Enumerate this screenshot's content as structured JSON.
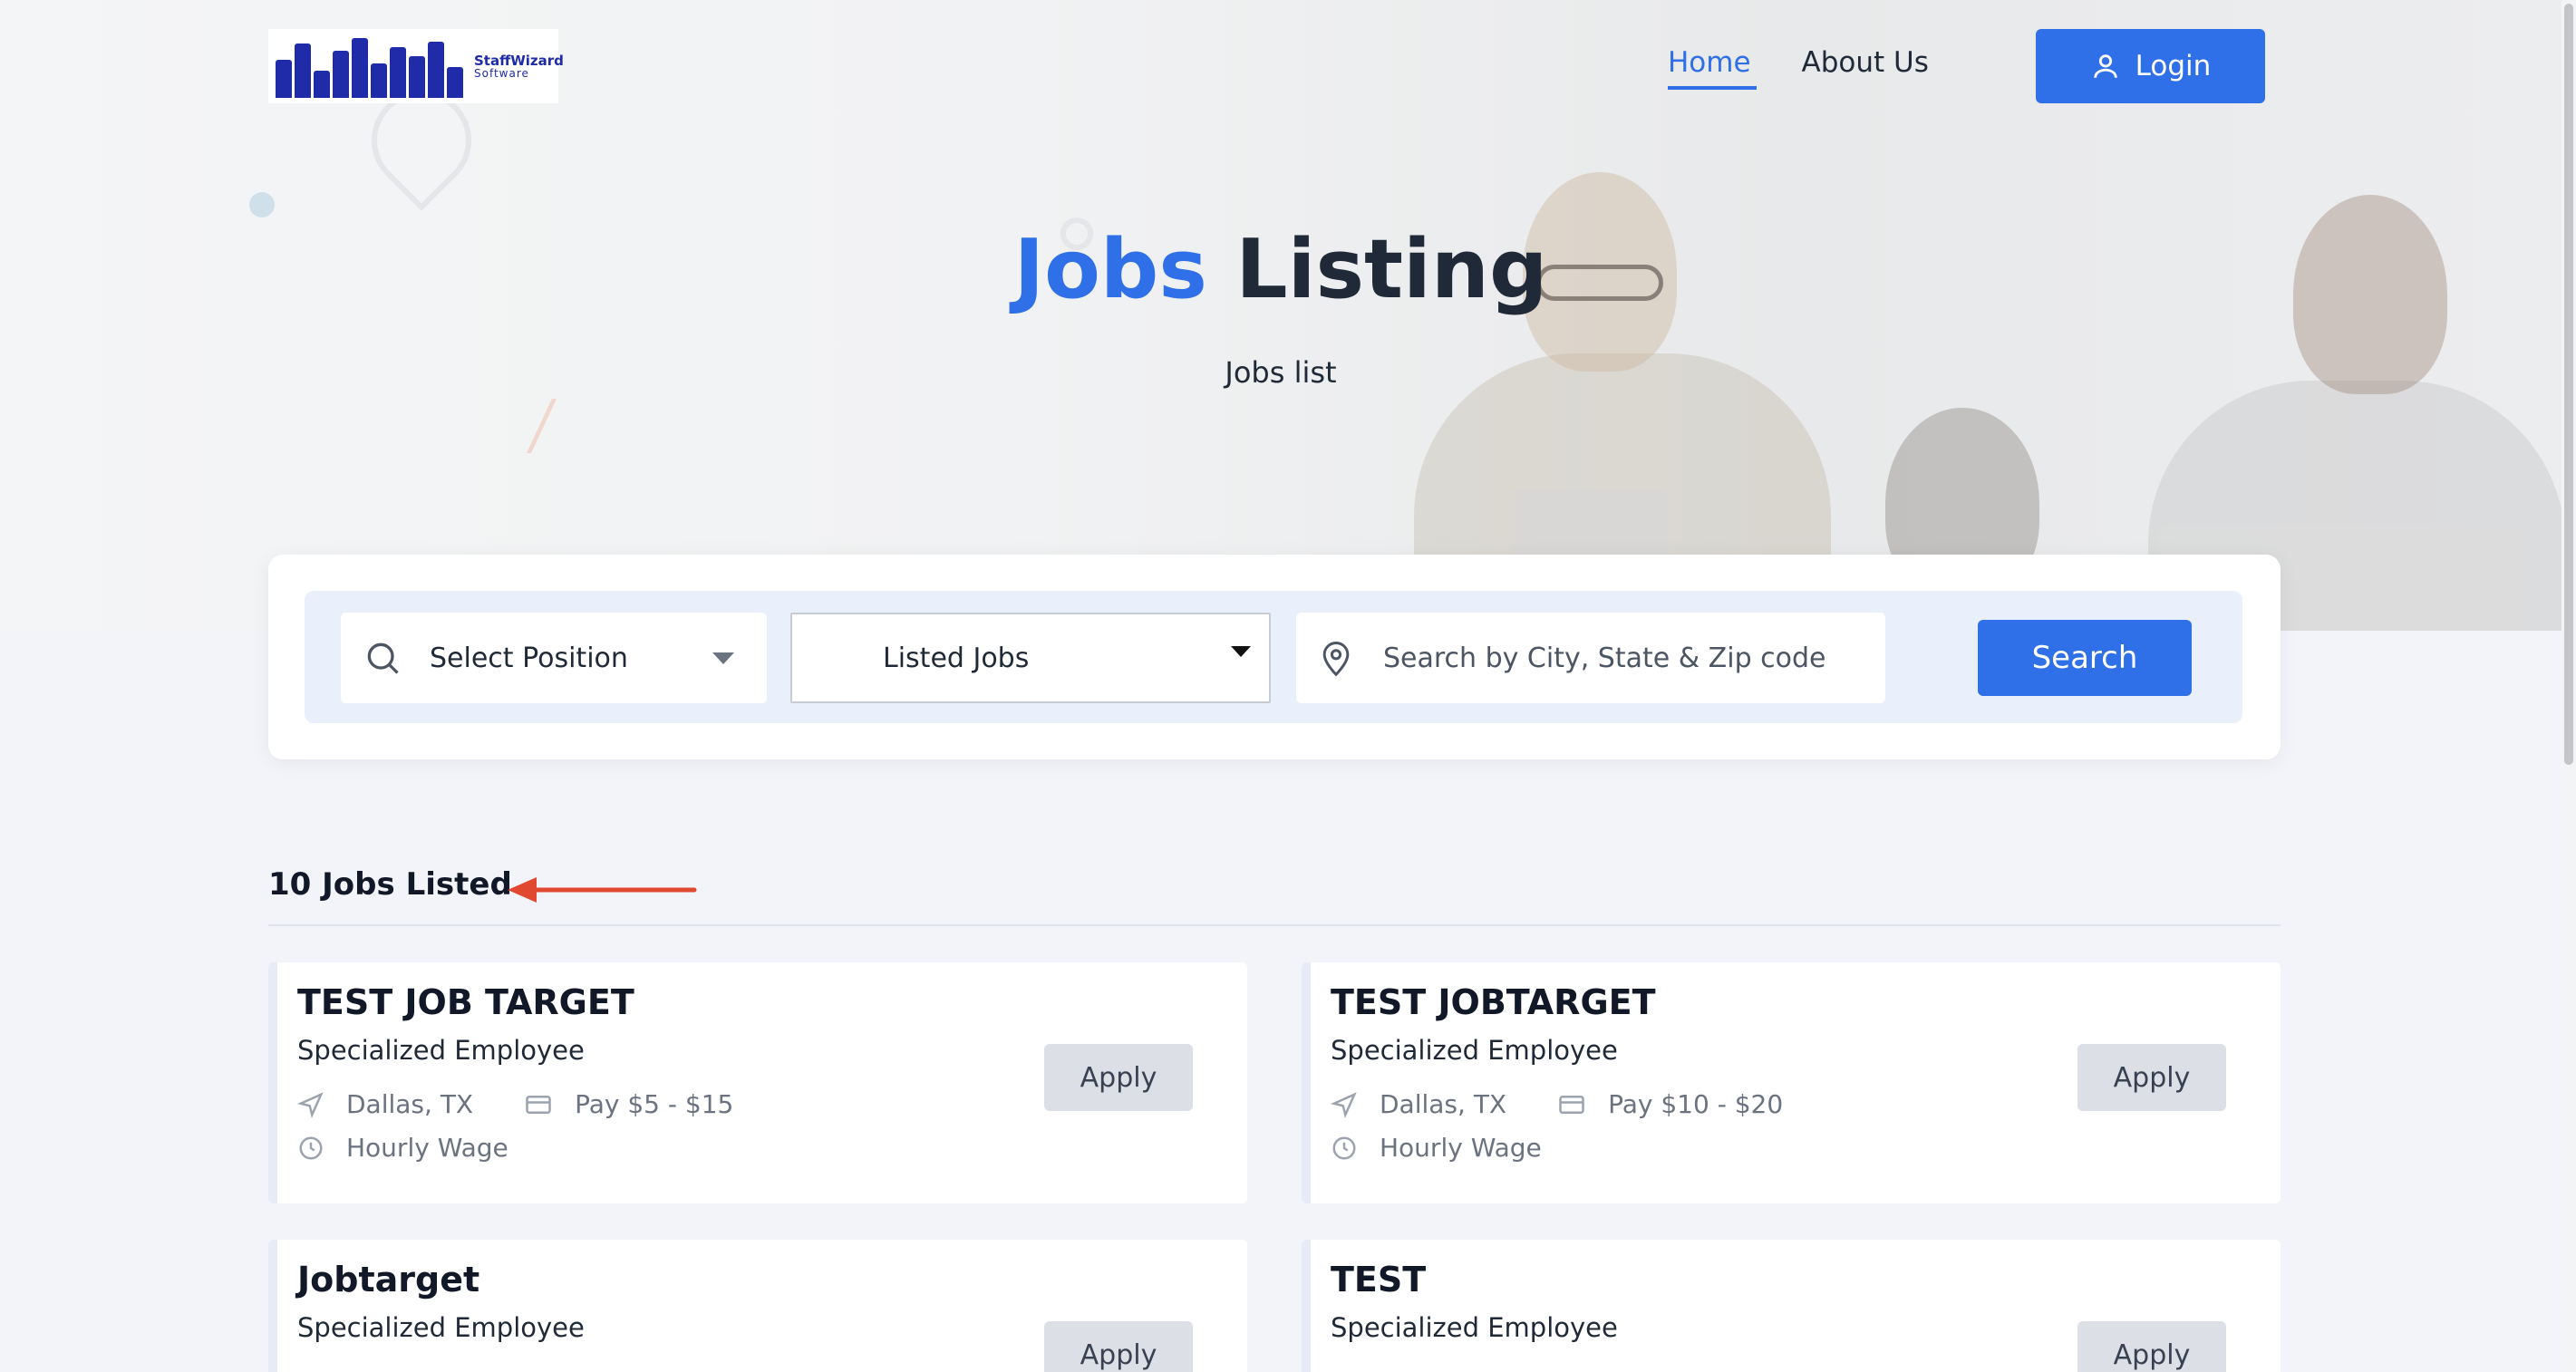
{
  "header": {
    "logo": {
      "line1": "StaffWizard",
      "line2": "Software"
    },
    "nav": [
      {
        "label": "Home",
        "active": true
      },
      {
        "label": "About Us",
        "active": false
      }
    ],
    "login_label": "Login"
  },
  "hero": {
    "title_accent": "Jobs",
    "title_rest": "Listing",
    "subtitle": "Jobs list"
  },
  "search": {
    "position_select": "Select Position",
    "listing_select": "Listed Jobs",
    "location_placeholder": "Search by City, State & Zip code",
    "button_label": "Search"
  },
  "results": {
    "count_label": "10 Jobs Listed"
  },
  "jobs": [
    {
      "title": "TEST JOB TARGET",
      "position": "Specialized Employee",
      "location": "Dallas, TX",
      "pay": "Pay  $5 - $15",
      "wage_type": "Hourly Wage",
      "apply_label": "Apply"
    },
    {
      "title": "TEST JOBTARGET",
      "position": "Specialized Employee",
      "location": "Dallas, TX",
      "pay": "Pay  $10 - $20",
      "wage_type": "Hourly Wage",
      "apply_label": "Apply"
    },
    {
      "title": "Jobtarget",
      "position": "Specialized Employee",
      "apply_label": "Apply"
    },
    {
      "title": "TEST",
      "position": "Specialized Employee",
      "apply_label": "Apply"
    }
  ],
  "colors": {
    "accent": "#2f6fe8",
    "annotation_arrow": "#e0482f"
  }
}
